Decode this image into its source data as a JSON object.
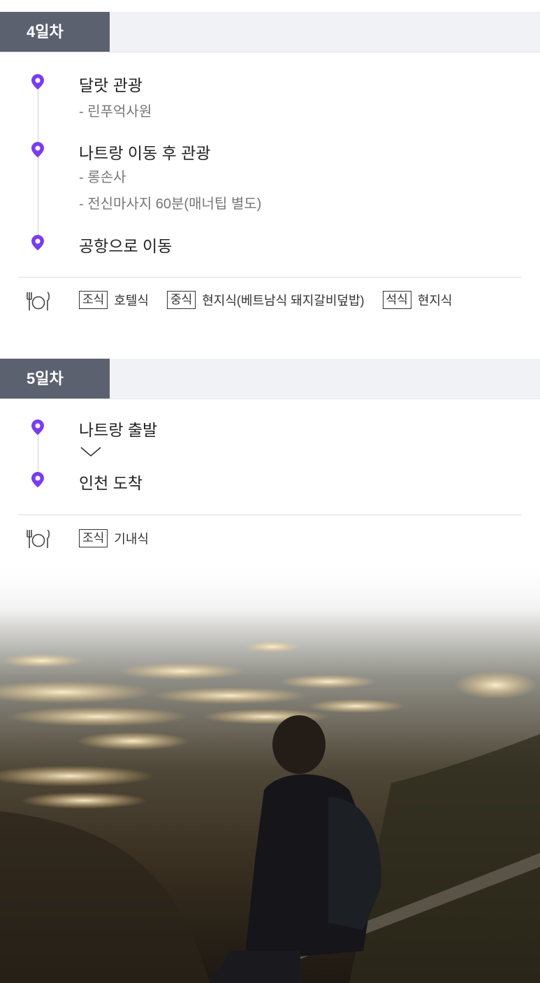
{
  "days": [
    {
      "label": "4일차",
      "stops": [
        {
          "title": "달랏 관광",
          "subs": [
            "- 린푸억사원"
          ]
        },
        {
          "title": "나트랑 이동 후 관광",
          "subs": [
            "- 롱손사",
            "- 전신마사지 60분(매너팁 별도)"
          ]
        },
        {
          "title": "공항으로 이동",
          "subs": []
        }
      ],
      "meals": [
        {
          "tag": "조식",
          "text": "호텔식"
        },
        {
          "tag": "중식",
          "text": "현지식(베트남식 돼지갈비덮밥)"
        },
        {
          "tag": "석식",
          "text": "현지식"
        }
      ]
    },
    {
      "label": "5일차",
      "stops": [
        {
          "title": "나트랑 출발",
          "subs": []
        },
        {
          "title": "인천 도착",
          "subs": []
        }
      ],
      "meals": [
        {
          "tag": "조식",
          "text": "기내식"
        }
      ]
    }
  ],
  "icons": {
    "pin": "map-pin-icon",
    "meal": "fork-plate-knife-icon",
    "arrow": "chevron-down-icon"
  },
  "colors": {
    "accent": "#7a3cf0",
    "day_badge": "#5c6170",
    "day_bar": "#f1f2f5"
  }
}
